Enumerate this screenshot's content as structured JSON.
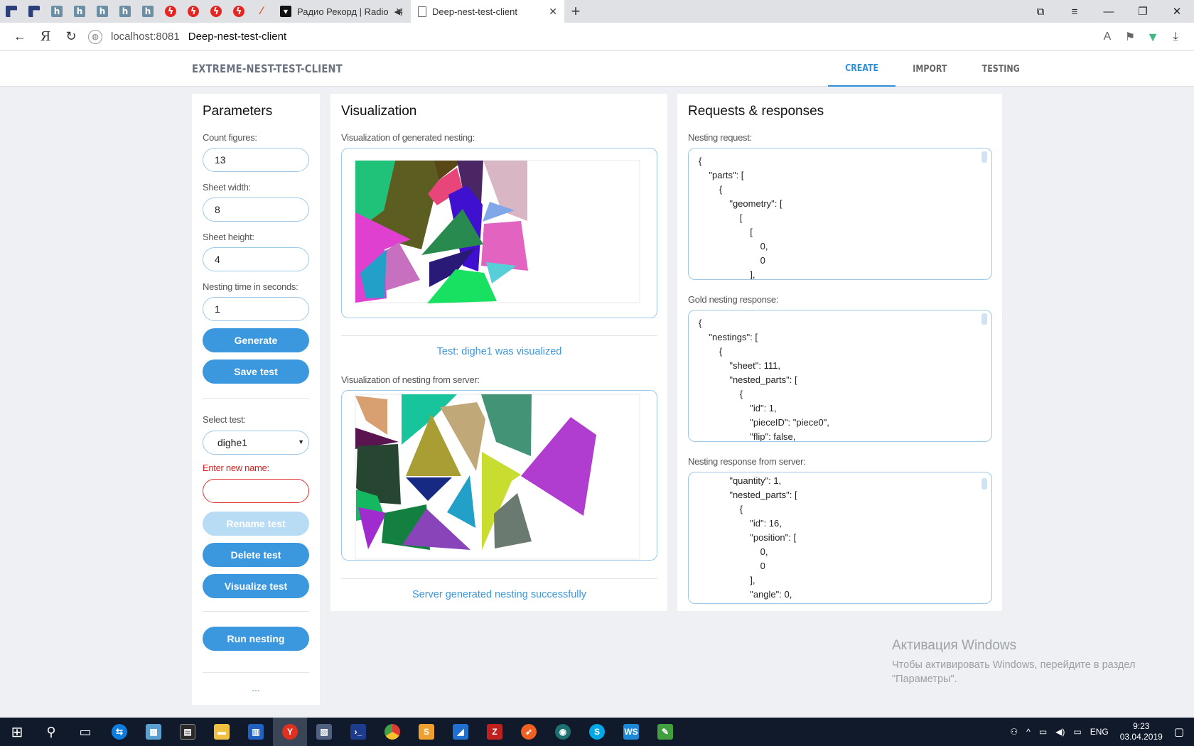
{
  "browser": {
    "tabs": [
      {
        "title": "Радио Рекорд | Radio"
      },
      {
        "title": "Deep-nest-test-client"
      }
    ],
    "url_host": "localhost:8081",
    "page_title": "Deep-nest-test-client"
  },
  "app": {
    "brand": "EXTREME-NEST-TEST-CLIENT",
    "nav": [
      "CREATE",
      "IMPORT",
      "TESTING"
    ],
    "active_nav": "CREATE"
  },
  "parameters": {
    "title": "Parameters",
    "count_label": "Count figures:",
    "count_value": "13",
    "width_label": "Sheet width:",
    "width_value": "8",
    "height_label": "Sheet height:",
    "height_value": "4",
    "time_label": "Nesting time in seconds:",
    "time_value": "1",
    "generate": "Generate",
    "save": "Save test",
    "select_label": "Select test:",
    "select_value": "dighe1",
    "new_name_label": "Enter new name:",
    "new_name_value": "",
    "rename": "Rename test",
    "delete": "Delete test",
    "visualize": "Visualize test",
    "run": "Run nesting",
    "more": "..."
  },
  "visualization": {
    "title": "Visualization",
    "generated_label": "Visualization of generated nesting:",
    "generated_status": "Test: dighe1 was visualized",
    "server_label": "Visualization of nesting from server:",
    "server_status": "Server generated nesting successfully"
  },
  "requests": {
    "title": "Requests & responses",
    "request_label": "Nesting request:",
    "request_text": "{\n    \"parts\": [\n        {\n            \"geometry\": [\n                [\n                    [\n                        0,\n                        0\n                    ],",
    "gold_label": "Gold nesting response:",
    "gold_text": "{\n    \"nestings\": [\n        {\n            \"sheet\": 111,\n            \"nested_parts\": [\n                {\n                    \"id\": 1,\n                    \"pieceID\": \"piece0\",\n                    \"flip\": false,",
    "server_label": "Nesting response from server:",
    "server_text": "            \"quantity\": 1,\n            \"nested_parts\": [\n                {\n                    \"id\": 16,\n                    \"position\": [\n                        0,\n                        0\n                    ],\n                    \"angle\": 0,"
  },
  "windows": {
    "activation_title": "Активация Windows",
    "activation_text_1": "Чтобы активировать Windows, перейдите в раздел",
    "activation_text_2": "\"Параметры\".",
    "lang": "ENG",
    "time": "9:23",
    "date": "03.04.2019"
  },
  "colors": {
    "accent": "#3b97de",
    "error": "#e02020",
    "border": "#9ec8e8"
  }
}
